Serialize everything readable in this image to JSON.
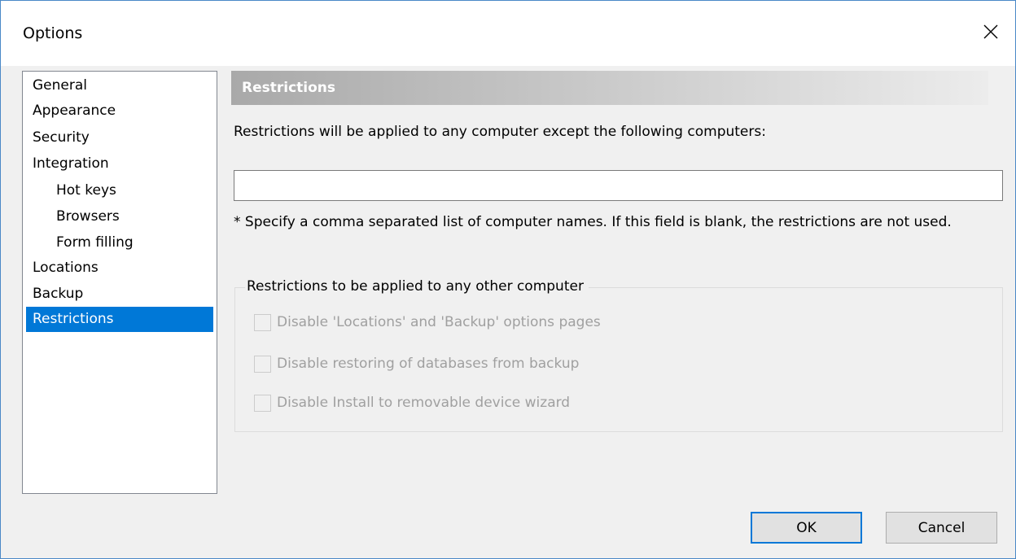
{
  "window": {
    "title": "Options",
    "close_icon": "close-icon"
  },
  "nav": {
    "items": [
      {
        "label": "General",
        "level": 0,
        "selected": false
      },
      {
        "label": "Appearance",
        "level": 0,
        "selected": false
      },
      {
        "label": "Security",
        "level": 0,
        "selected": false
      },
      {
        "label": "Integration",
        "level": 0,
        "selected": false
      },
      {
        "label": "Hot keys",
        "level": 1,
        "selected": false
      },
      {
        "label": "Browsers",
        "level": 1,
        "selected": false
      },
      {
        "label": "Form filling",
        "level": 1,
        "selected": false
      },
      {
        "label": "Locations",
        "level": 0,
        "selected": false
      },
      {
        "label": "Backup",
        "level": 0,
        "selected": false
      },
      {
        "label": "Restrictions",
        "level": 0,
        "selected": true
      }
    ]
  },
  "page": {
    "header": "Restrictions",
    "description": "Restrictions will be applied to any computer except the following computers:",
    "computers_input": {
      "value": "",
      "placeholder": ""
    },
    "hint": "* Specify a comma separated list of computer names. If this field is blank, the restrictions are not used.",
    "group": {
      "legend": "Restrictions to be applied to any other computer",
      "options": [
        {
          "label": "Disable 'Locations' and 'Backup' options pages",
          "checked": false,
          "enabled": false
        },
        {
          "label": "Disable restoring of databases from backup",
          "checked": false,
          "enabled": false
        },
        {
          "label": "Disable Install to removable device wizard",
          "checked": false,
          "enabled": false
        }
      ]
    }
  },
  "buttons": {
    "ok": "OK",
    "cancel": "Cancel"
  },
  "colors": {
    "selection": "#0078d7",
    "window_border": "#4a88c7",
    "disabled_text": "#a0a0a0"
  }
}
